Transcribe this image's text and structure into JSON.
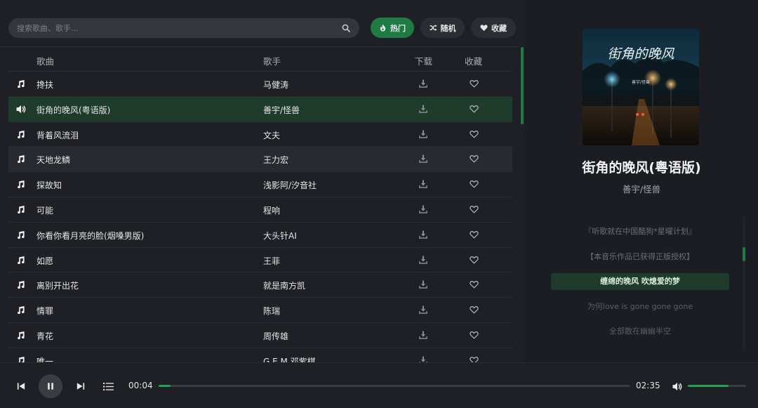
{
  "search": {
    "placeholder": "搜索歌曲、歌手..."
  },
  "filters": [
    {
      "label": "热门",
      "icon": "flame-icon",
      "active": true
    },
    {
      "label": "随机",
      "icon": "shuffle-icon",
      "active": false
    },
    {
      "label": "收藏",
      "icon": "heart-icon",
      "active": false
    }
  ],
  "table": {
    "headers": {
      "song": "歌曲",
      "artist": "歌手",
      "download": "下载",
      "favorite": "收藏"
    },
    "rows": [
      {
        "song": "搀扶",
        "artist": "马健涛",
        "state": "normal"
      },
      {
        "song": "街角的晚风(粤语版)",
        "artist": "善宇/怪兽",
        "state": "playing"
      },
      {
        "song": "背着风流泪",
        "artist": "文夫",
        "state": "normal"
      },
      {
        "song": "天地龙鳞",
        "artist": "王力宏",
        "state": "hover"
      },
      {
        "song": "探故知",
        "artist": "浅影阿/汐音社",
        "state": "normal"
      },
      {
        "song": "可能",
        "artist": "程响",
        "state": "normal"
      },
      {
        "song": "你看你看月亮的脸(烟嗓男版)",
        "artist": "大头针AI",
        "state": "normal"
      },
      {
        "song": "如愿",
        "artist": "王菲",
        "state": "normal"
      },
      {
        "song": "离别开出花",
        "artist": "就是南方凯",
        "state": "normal"
      },
      {
        "song": "情罪",
        "artist": "陈瑞",
        "state": "normal"
      },
      {
        "song": "青花",
        "artist": "周传雄",
        "state": "normal"
      },
      {
        "song": "唯一",
        "artist": "G.E.M.邓紫棋",
        "state": "normal"
      }
    ]
  },
  "now_playing": {
    "title": "街角的晚风(粤语版)",
    "artist": "善宇/怪兽",
    "cover_text": "街角的晚风",
    "cover_subtext": "善宇/怪兽"
  },
  "lyrics": [
    {
      "text": "『听歌就在中国酷狗*星曜计划』",
      "state": "past"
    },
    {
      "text": "【本音乐作品已获得正版授权】",
      "state": "past"
    },
    {
      "text": "缠绵的晚风 吹熄爱的梦",
      "state": "current"
    },
    {
      "text": "为何love is gone gone gone",
      "state": "next"
    },
    {
      "text": "全部散在幽幽半空",
      "state": "next"
    }
  ],
  "player": {
    "current_time": "00:04",
    "total_time": "02:35",
    "progress": 0.026,
    "volume": 0.7
  },
  "colors": {
    "accent": "#1f7a43",
    "playing_row": "#1f3b2b",
    "progress": "#24a050"
  }
}
